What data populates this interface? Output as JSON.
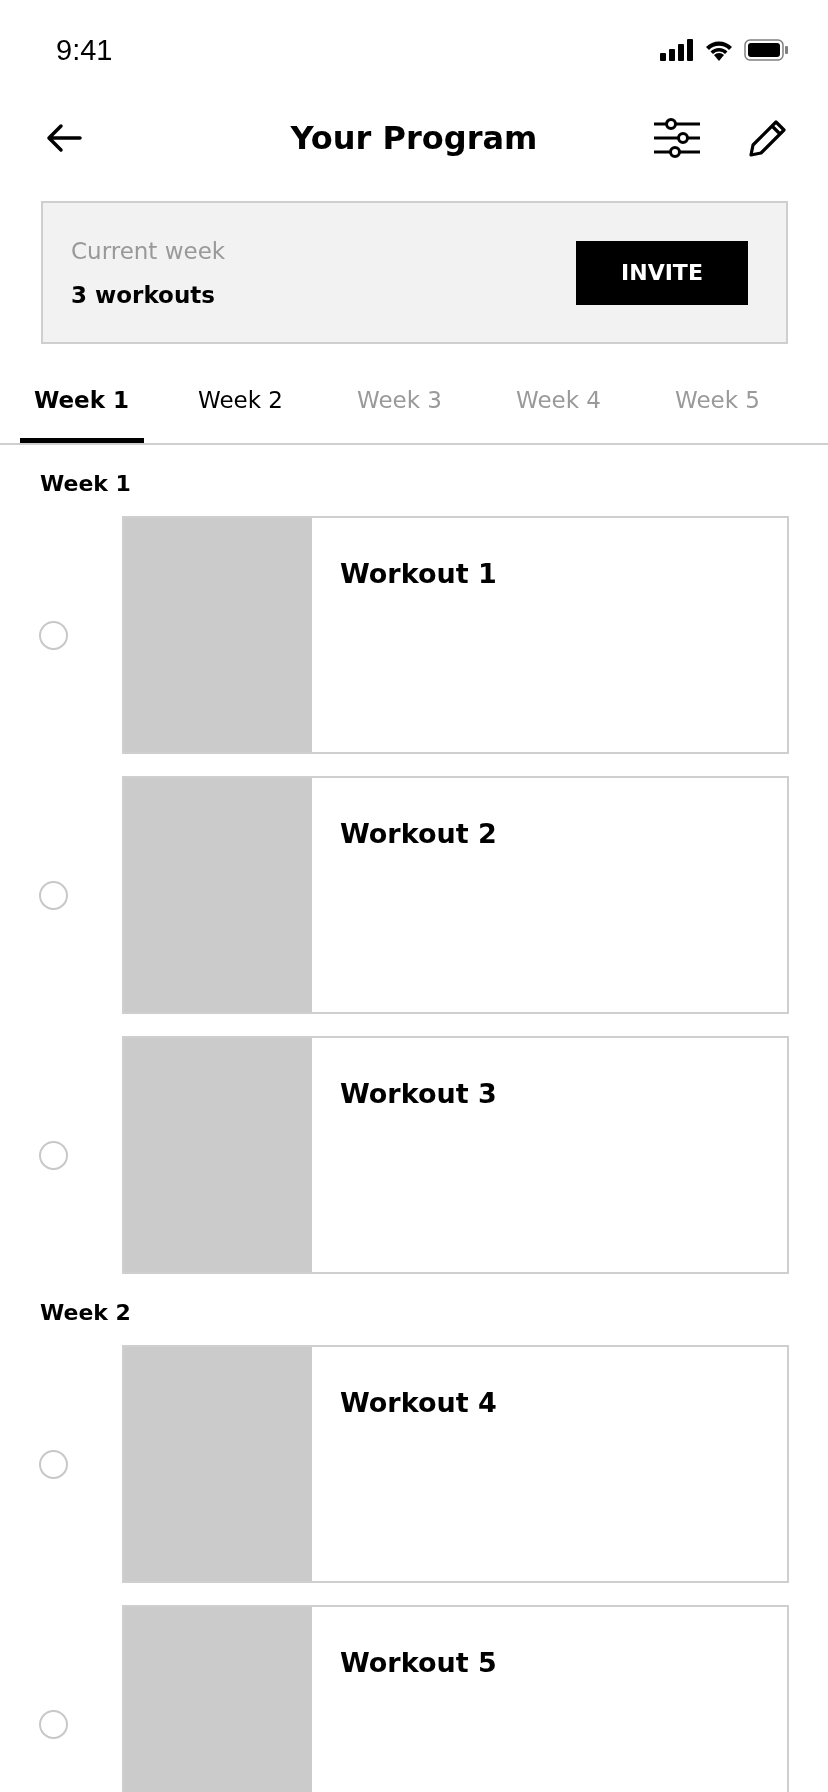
{
  "status_bar": {
    "time": "9:41"
  },
  "header": {
    "title": "Your Program"
  },
  "current_week": {
    "label": "Current week",
    "value": "3 workouts",
    "button": "INVITE"
  },
  "tabs": [
    {
      "label": "Week 1",
      "selected": true,
      "disabled": false
    },
    {
      "label": "Week 2",
      "selected": false,
      "disabled": false
    },
    {
      "label": "Week 3",
      "selected": false,
      "disabled": true
    },
    {
      "label": "Week 4",
      "selected": false,
      "disabled": true
    },
    {
      "label": "Week 5",
      "selected": false,
      "disabled": true
    }
  ],
  "sections": [
    {
      "title": "Week 1",
      "workouts": [
        {
          "title": "Workout 1",
          "checked": false
        },
        {
          "title": "Workout 2",
          "checked": false
        },
        {
          "title": "Workout 3",
          "checked": false
        }
      ]
    },
    {
      "title": "Week 2",
      "workouts": [
        {
          "title": "Workout 4",
          "checked": false
        },
        {
          "title": "Workout 5",
          "checked": false
        }
      ]
    }
  ]
}
